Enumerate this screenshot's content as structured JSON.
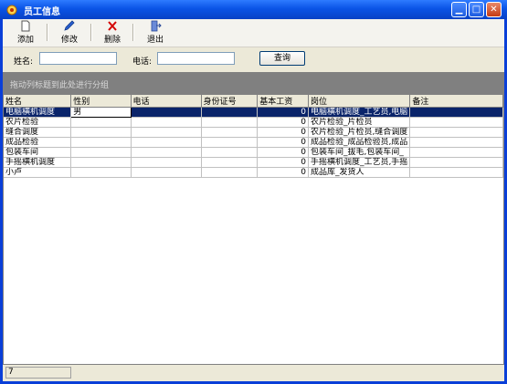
{
  "window": {
    "title": "员工信息"
  },
  "toolbar": {
    "add": "添加",
    "edit": "修改",
    "delete": "删除",
    "exit": "退出"
  },
  "search": {
    "name_label": "姓名:",
    "name_value": "",
    "phone_label": "电话:",
    "phone_value": "",
    "button": "查询"
  },
  "group_hint": "拖动列标题到此处进行分组",
  "grid": {
    "columns": [
      "姓名",
      "性别",
      "电话",
      "身份证号",
      "基本工资",
      "岗位",
      "备注"
    ],
    "rows": [
      [
        "电脑横机调度",
        "男",
        "",
        "",
        "0",
        "电脑横机调度_工艺员,电脑",
        ""
      ],
      [
        "农片检验",
        "",
        "",
        "",
        "0",
        "农片检验_片检员",
        ""
      ],
      [
        "缝合调度",
        "",
        "",
        "",
        "0",
        "农片检验_片检员,缝合调度",
        ""
      ],
      [
        "成品检验",
        "",
        "",
        "",
        "0",
        "成品检验_成品检验员,成品",
        ""
      ],
      [
        "包装车间",
        "",
        "",
        "",
        "0",
        "包装车间_拔毛,包装车间_",
        ""
      ],
      [
        "手摇横机调度",
        "",
        "",
        "",
        "0",
        "手摇横机调度_工艺员,手摇",
        ""
      ],
      [
        "小卢",
        "",
        "",
        "",
        "0",
        "成品库_发货人",
        ""
      ]
    ]
  },
  "status": {
    "count": "7"
  },
  "icons": {
    "window": "app-icon",
    "add": "new-doc-icon",
    "edit": "pencil-icon",
    "delete": "x-icon",
    "exit": "exit-door-icon"
  },
  "colors": {
    "titlebar": "#0a54e6",
    "selected_row": "#0a246a",
    "group_panel": "#808080",
    "delete_icon": "#d40000"
  }
}
